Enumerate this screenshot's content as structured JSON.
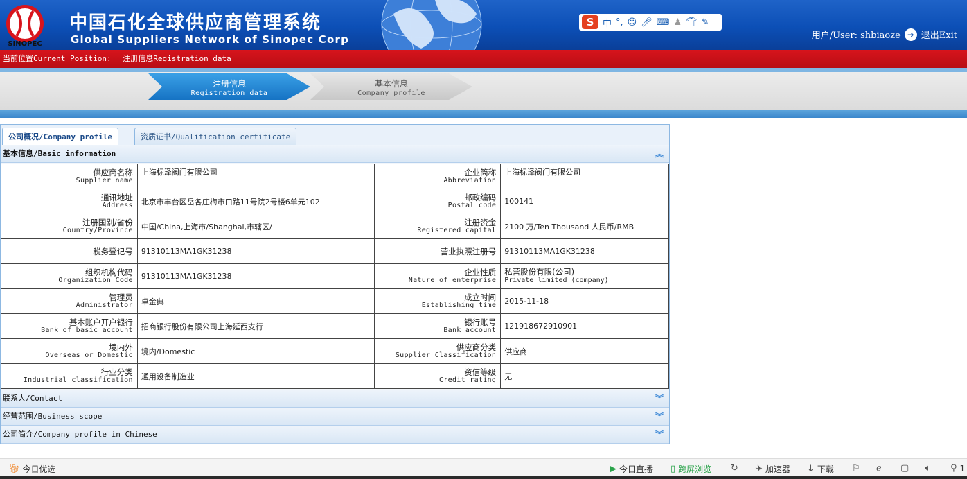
{
  "header": {
    "title_cn": "中国石化全球供应商管理系统",
    "title_en": "Global Suppliers Network of Sinopec Corp",
    "logo_text": "SINOPEC",
    "ime": {
      "logo": "S",
      "mode": "中",
      "icons": [
        "punctuation-icon",
        "emoji-icon",
        "microphone-icon",
        "keyboard-icon",
        "user-icon",
        "skin-icon",
        "settings-icon"
      ]
    },
    "user_label": "用户/User: shbiaoze",
    "exit_label": "退出Exit"
  },
  "position": {
    "label": "当前位置Current Position:",
    "value": "注册信息Registration data"
  },
  "steps": [
    {
      "cn": "注册信息",
      "en": "Registration data",
      "active": true
    },
    {
      "cn": "基本信息",
      "en": "Company profile",
      "active": false
    }
  ],
  "tabs": [
    {
      "label": "公司概况/Company profile",
      "active": true
    },
    {
      "label": "资质证书/Qualification certificate",
      "active": false
    }
  ],
  "sections": {
    "basic": {
      "title": "基本信息/Basic information",
      "expanded": true
    },
    "contact": {
      "title": "联系人/Contact",
      "expanded": false
    },
    "scope": {
      "title": "经营范围/Business scope",
      "expanded": false
    },
    "intro": {
      "title": "公司简介/Company profile in Chinese",
      "expanded": false
    }
  },
  "basic_info": [
    {
      "l1_cn": "供应商名称",
      "l1_en": "Supplier name",
      "v1": "上海标泽阀门有限公司",
      "l2_cn": "企业简称",
      "l2_en": "Abbreviation",
      "v2": "上海标泽阀门有限公司"
    },
    {
      "l1_cn": "通讯地址",
      "l1_en": "Address",
      "v1": "北京市丰台区岳各庄梅市口路11号院2号楼6单元102",
      "l2_cn": "邮政编码",
      "l2_en": "Postal code",
      "v2": "100141"
    },
    {
      "l1_cn": "注册国别/省份",
      "l1_en": "Country/Province",
      "v1": "中国/China,上海市/Shanghai,市辖区/",
      "l2_cn": "注册资金",
      "l2_en": "Registered capital",
      "v2": "2100 万/Ten Thousand 人民币/RMB"
    },
    {
      "l1_cn": "税务登记号",
      "l1_en": "",
      "v1": "91310113MA1GK31238",
      "l2_cn": "营业执照注册号",
      "l2_en": "",
      "v2": "91310113MA1GK31238"
    },
    {
      "l1_cn": "组织机构代码",
      "l1_en": "Organization Code",
      "v1": "91310113MA1GK31238",
      "l2_cn": "企业性质",
      "l2_en": "Nature of enterprise",
      "v2": "私营股份有限(公司)",
      "v2_en": "Private limited (company)"
    },
    {
      "l1_cn": "管理员",
      "l1_en": "Administrator",
      "v1": "卓金典",
      "l2_cn": "成立时间",
      "l2_en": "Establishing time",
      "v2": "2015-11-18"
    },
    {
      "l1_cn": "基本账户开户银行",
      "l1_en": "Bank of basic account",
      "v1": "招商银行股份有限公司上海延西支行",
      "l2_cn": "银行账号",
      "l2_en": "Bank account",
      "v2": "121918672910901"
    },
    {
      "l1_cn": "境内外",
      "l1_en": "Overseas or Domestic",
      "v1": "境内/Domestic",
      "l2_cn": "供应商分类",
      "l2_en": "Supplier Classification",
      "v2": "供应商"
    },
    {
      "l1_cn": "行业分类",
      "l1_en": "Industrial classification",
      "v1": "通用设备制造业",
      "l2_cn": "资信等级",
      "l2_en": "Credit rating",
      "v2": "无"
    }
  ],
  "statusbar": {
    "left": "今日优选",
    "live": "今日直播",
    "cross_screen": "跨屏浏览",
    "accelerator": "加速器",
    "download": "下载",
    "zoom_prefix": "1"
  },
  "colors": {
    "header_blue": "#0c4fb6",
    "position_red": "#c8101a",
    "active_step": "#1673c4",
    "panel_border": "#8db8e2"
  }
}
